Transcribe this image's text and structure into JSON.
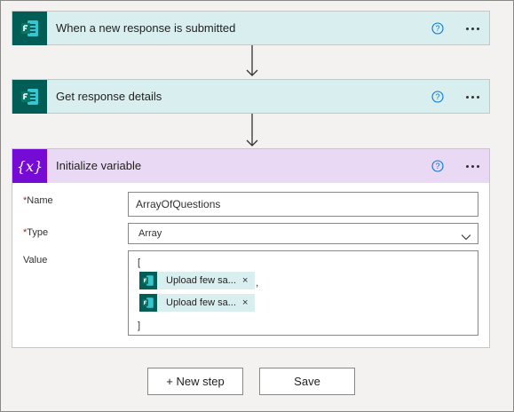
{
  "cards": {
    "trigger": {
      "title": "When a new response is submitted",
      "icon": "forms-icon"
    },
    "action": {
      "title": "Get response details",
      "icon": "forms-icon"
    },
    "variable": {
      "title": "Initialize variable",
      "icon": "variable-icon",
      "glyph": "{x}"
    }
  },
  "fields": {
    "name": {
      "label": "Name",
      "required_mark": "*",
      "value": "ArrayOfQuestions"
    },
    "type": {
      "label": "Type",
      "required_mark": "*",
      "value": "Array"
    },
    "value": {
      "label": "Value",
      "open_bracket": "[",
      "close_bracket": "]",
      "separator": ",",
      "tokens": [
        {
          "label": "Upload few sa...",
          "close": "×"
        },
        {
          "label": "Upload few sa...",
          "close": "×"
        }
      ]
    }
  },
  "buttons": {
    "new_step": "+ New step",
    "save": "Save"
  },
  "colors": {
    "forms_icon_bg": "#035d57",
    "forms_card_bg": "#d9efef",
    "variable_icon_bg": "#770bd6",
    "variable_card_bg": "#ead9f5",
    "help_blue": "#0078d4",
    "required_red": "#a4262c"
  }
}
